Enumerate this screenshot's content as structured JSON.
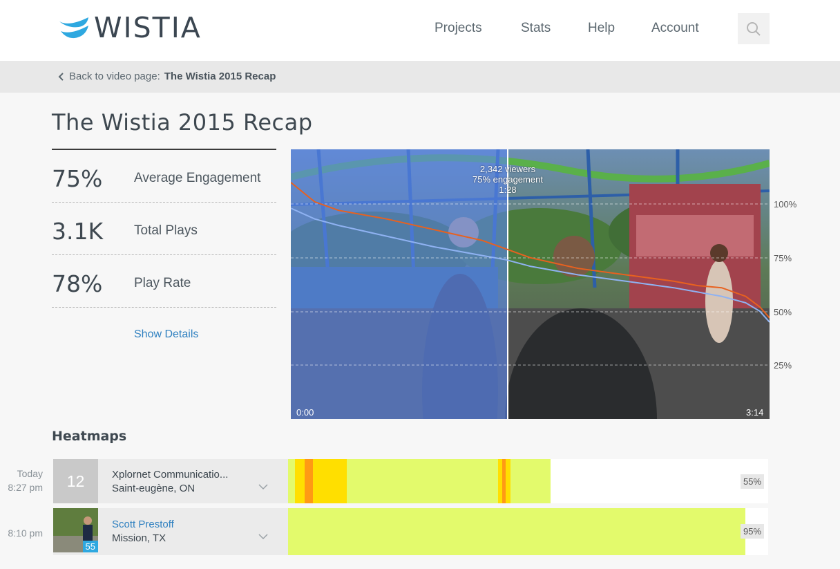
{
  "header": {
    "logo_text": "WISTIA",
    "nav": [
      "Projects",
      "Stats",
      "Help",
      "Account"
    ],
    "brand_color": "#2ea8e0"
  },
  "breadcrumb": {
    "prefix": "Back to video page:",
    "video_name": "The Wistia 2015 Recap"
  },
  "page_title": "The Wistia 2015 Recap",
  "stats": [
    {
      "value": "75%",
      "label": "Average Engagement"
    },
    {
      "value": "3.1K",
      "label": "Total Plays"
    },
    {
      "value": "78%",
      "label": "Play Rate"
    }
  ],
  "show_details": "Show Details",
  "video": {
    "tooltip_viewers": "2,342 viewers",
    "tooltip_engagement": "75% engagement",
    "tooltip_time": "1:28",
    "time_start": "0:00",
    "time_end": "3:14",
    "y_labels": [
      "100%",
      "75%",
      "50%",
      "25%"
    ]
  },
  "chart_data": {
    "type": "line",
    "title": "",
    "xlabel": "",
    "ylabel": "",
    "x_range": [
      "0:00",
      "3:14"
    ],
    "ylim": [
      0,
      125
    ],
    "y_ticks": [
      100,
      75,
      50,
      25
    ],
    "series": [
      {
        "name": "",
        "color": "#e8611f",
        "x_fraction": [
          0,
          0.05,
          0.1,
          0.2,
          0.3,
          0.4,
          0.45,
          0.5,
          0.6,
          0.7,
          0.8,
          0.85,
          0.9,
          0.95,
          0.98,
          1.0
        ],
        "values": [
          110,
          101,
          97,
          93,
          88,
          83,
          79,
          75,
          70,
          67,
          64,
          62,
          61,
          57,
          52,
          47
        ]
      },
      {
        "name": "",
        "color": "#8fb2f2",
        "x_fraction": [
          0,
          0.05,
          0.1,
          0.2,
          0.3,
          0.4,
          0.45,
          0.5,
          0.6,
          0.7,
          0.8,
          0.85,
          0.9,
          0.95,
          0.98,
          1.0
        ],
        "values": [
          98,
          93,
          90,
          85,
          80,
          76,
          74,
          71,
          67,
          64,
          61,
          59,
          57,
          54,
          50,
          45
        ]
      }
    ],
    "marker_time": "1:28",
    "marker_engagement": 75
  },
  "heatmaps": {
    "title": "Heatmaps",
    "rows": [
      {
        "time_day": "Today",
        "time": "8:27 pm",
        "badge": "12",
        "name": "Xplornet Communicatio...",
        "location": "Saint-eugène, ON",
        "percent": "55%",
        "watched_fraction": 0.55
      },
      {
        "time_day": "",
        "time": "8:10 pm",
        "badge": "55",
        "name": "Scott Prestoff",
        "location": "Mission, TX",
        "percent": "95%",
        "watched_fraction": 0.95
      }
    ],
    "colors": {
      "watched": "#e3fa6c",
      "rewatched": "#ffdf00",
      "rewatched_more": "#ff9a14"
    }
  }
}
